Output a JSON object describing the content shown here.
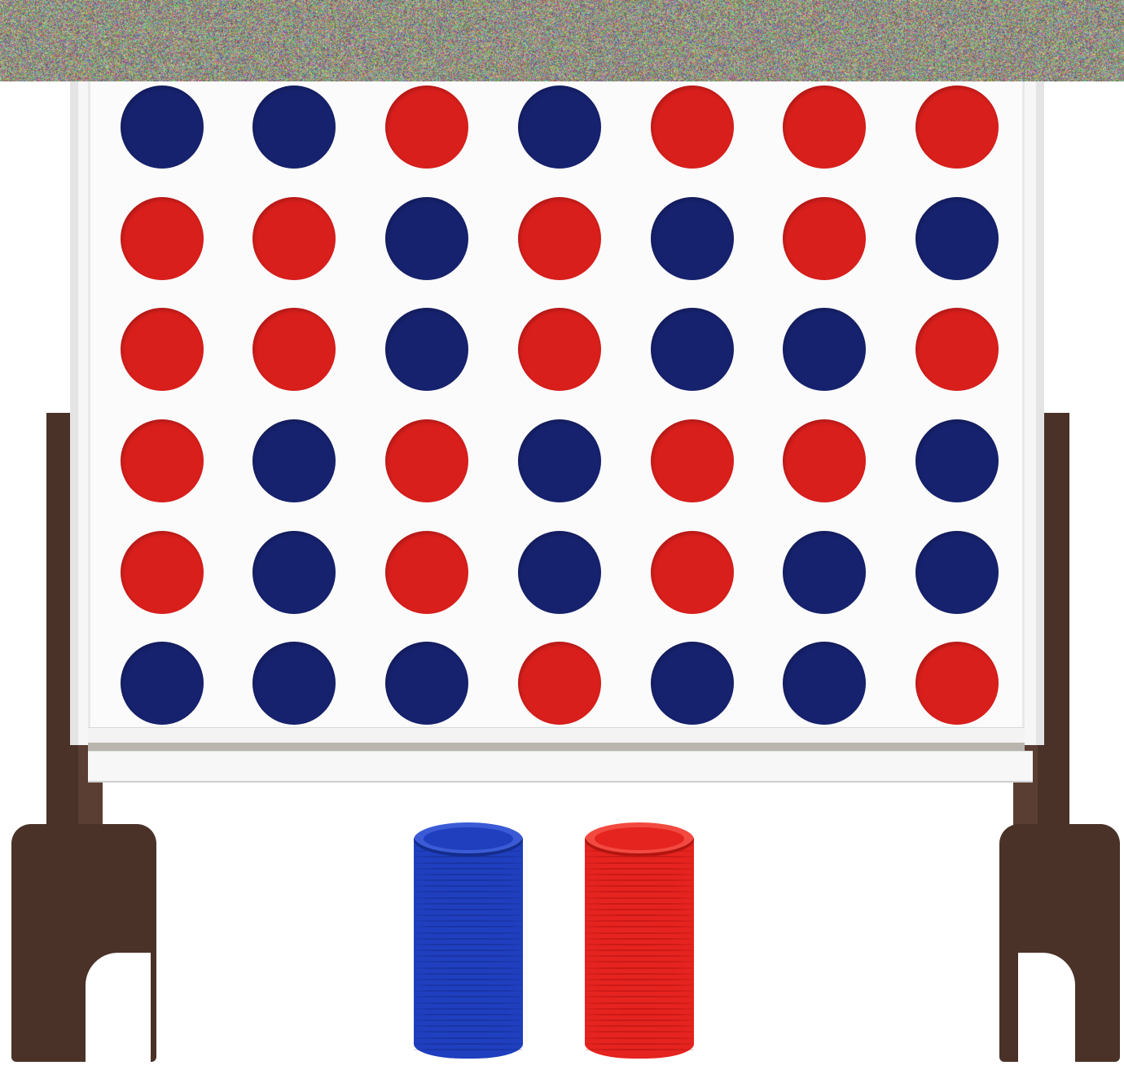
{
  "image": {
    "description_colors": {
      "red": "#d81f1c",
      "blue": "#17226e",
      "board": "#f7f7f7",
      "wood": "#4a3228",
      "chip_blue": "#1f3fbf",
      "chip_red": "#e5231f"
    }
  },
  "board": {
    "rows": [
      [
        "blue",
        "blue",
        "red",
        "blue",
        "red",
        "red",
        "red"
      ],
      [
        "red",
        "red",
        "blue",
        "red",
        "blue",
        "red",
        "blue"
      ],
      [
        "red",
        "red",
        "blue",
        "red",
        "blue",
        "blue",
        "red"
      ],
      [
        "red",
        "blue",
        "red",
        "blue",
        "red",
        "red",
        "blue"
      ],
      [
        "red",
        "blue",
        "red",
        "blue",
        "red",
        "blue",
        "blue"
      ],
      [
        "blue",
        "blue",
        "blue",
        "red",
        "blue",
        "blue",
        "red"
      ]
    ]
  },
  "stacks": [
    {
      "color": "blue",
      "chips": 36
    },
    {
      "color": "red",
      "chips": 36
    }
  ]
}
